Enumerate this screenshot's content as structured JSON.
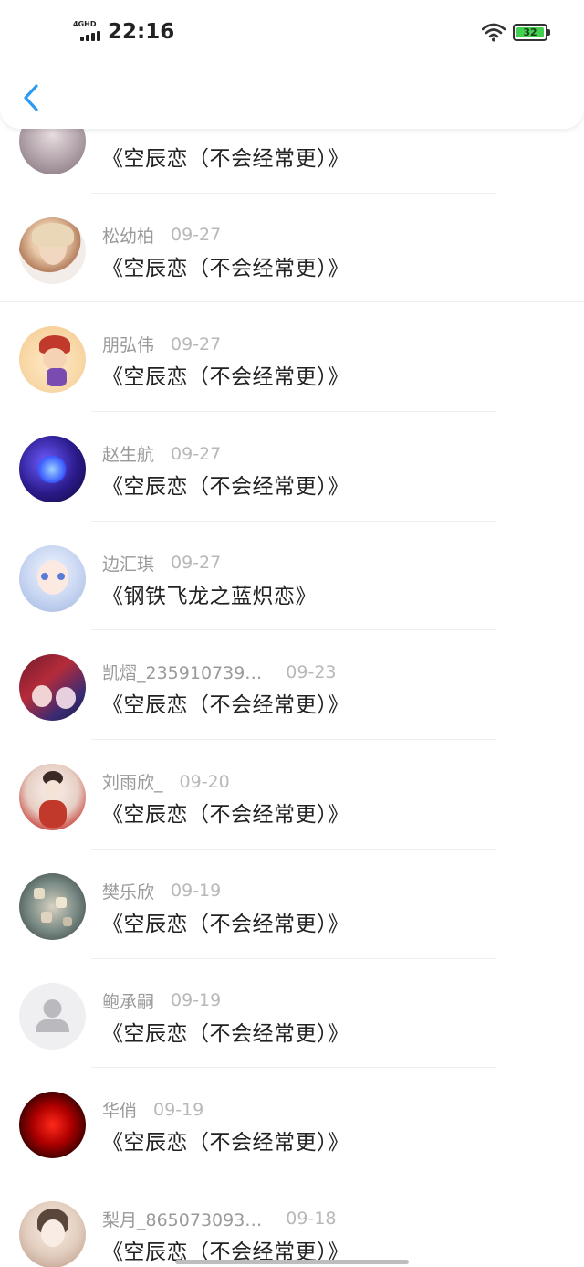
{
  "status_bar": {
    "network": "4GHD",
    "time": "22:16",
    "battery": "32",
    "battery_fill_percent": 32
  },
  "nav": {
    "back_icon": "chevron-left-icon"
  },
  "colors": {
    "accent": "#2b9af3",
    "battery_green": "#44d04f"
  },
  "items": [
    {
      "name": "",
      "date": "",
      "title": "《空辰恋（不会经常更）》"
    },
    {
      "name": "松幼柏",
      "date": "09-27",
      "title": "《空辰恋（不会经常更）》"
    },
    {
      "name": "朋弘伟",
      "date": "09-27",
      "title": "《空辰恋（不会经常更）》"
    },
    {
      "name": "赵生航",
      "date": "09-27",
      "title": "《空辰恋（不会经常更）》"
    },
    {
      "name": "边汇琪",
      "date": "09-27",
      "title": "《钢铁飞龙之蓝炽恋》"
    },
    {
      "name": "凯熠_235910739…",
      "date": "09-23",
      "title": "《空辰恋（不会经常更）》"
    },
    {
      "name": "刘雨欣_",
      "date": "09-20",
      "title": "《空辰恋（不会经常更）》"
    },
    {
      "name": "樊乐欣",
      "date": "09-19",
      "title": "《空辰恋（不会经常更）》"
    },
    {
      "name": "鲍承嗣",
      "date": "09-19",
      "title": "《空辰恋（不会经常更）》"
    },
    {
      "name": "华俏",
      "date": "09-19",
      "title": "《空辰恋（不会经常更）》"
    },
    {
      "name": "梨月_865073093…",
      "date": "09-18",
      "title": "《空辰恋（不会经常更）》"
    }
  ]
}
